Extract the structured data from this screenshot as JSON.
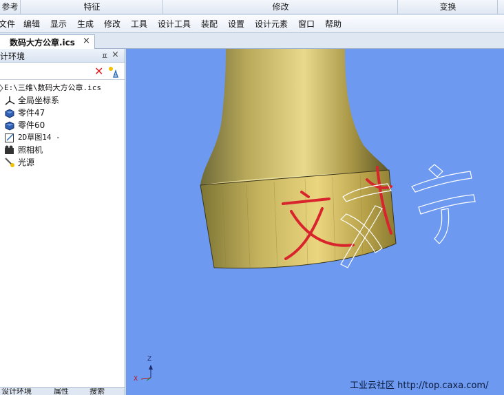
{
  "ribbon_groups": {
    "reference": "参考",
    "features": "特征",
    "modify": "修改",
    "transform": "变换"
  },
  "menu": {
    "file": "文件",
    "edit": "编辑",
    "display": "显示",
    "generate": "生成",
    "modify": "修改",
    "tools": "工具",
    "design_tools": "设计工具",
    "assembly": "装配",
    "settings": "设置",
    "design_elements": "设计元素",
    "window": "窗口",
    "help": "帮助"
  },
  "document_tab": {
    "title": "数码大方公章.ics",
    "close": "×"
  },
  "panel": {
    "title": "计环境",
    "pin": "ㅍ",
    "close": "×",
    "tree": {
      "root": "E:\\三维\\数码大方公章.ics",
      "items": [
        {
          "label": "全局坐标系",
          "icon": "axes-icon"
        },
        {
          "label": "零件47",
          "icon": "part-icon"
        },
        {
          "label": "零件60",
          "icon": "part-icon"
        },
        {
          "label": "2D草图14 -",
          "icon": "sketch-icon"
        },
        {
          "label": "照相机",
          "icon": "camera-icon"
        },
        {
          "label": "光源",
          "icon": "light-icon"
        }
      ]
    },
    "bottom_tabs": [
      "设计环境",
      "属性",
      "搜索"
    ]
  },
  "viewport": {
    "background": "#6d9af0",
    "triad_label_z": "Z",
    "triad_label_x": "X",
    "model_text_red": "文",
    "model_text_outline_1": "字",
    "model_text_outline_2": "字",
    "watermark": "工业云社区 http://top.caxa.com/"
  },
  "colors": {
    "accent_red": "#d8242c",
    "seal_gold": "#b8a14a"
  }
}
